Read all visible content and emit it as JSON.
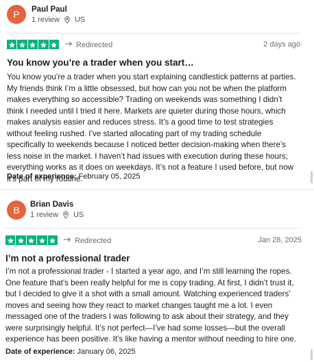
{
  "reviews": [
    {
      "reviewer": {
        "initial": "P",
        "name": "Paul Paul",
        "review_count": "1 review",
        "country": "US",
        "avatar_color": "#e4643c"
      },
      "rating_stars": 5,
      "redirected_label": "Redirected",
      "date": "2 days ago",
      "title": "You know you’re a trader when you start…",
      "body": "You know you’re a trader when you start explaining candlestick patterns at parties. My friends think I’m a little obsessed, but how can you not be when the platform makes everything so accessible? Trading on weekends was something I didn’t think I needed until I tried it here. Markets are quieter during those hours, which makes analysis easier and reduces stress. It’s a good time to test strategies without feeling rushed. I’ve started allocating part of my trading schedule specifically to weekends because I noticed better decision-making when there’s less noise in the market. I haven’t had issues with execution during these hours; everything works as it does on weekdays. It’s not a feature I used before, but now it’s part of my routine.",
      "experience_label": "Date of experience:",
      "experience_date": "February 05, 2025"
    },
    {
      "reviewer": {
        "initial": "B",
        "name": "Brian Davis",
        "review_count": "1 review",
        "country": "US",
        "avatar_color": "#e4643c"
      },
      "rating_stars": 5,
      "redirected_label": "Redirected",
      "date": "Jan 28, 2025",
      "title": "I’m not a professional trader",
      "body": "I’m not a professional trader - I started a year ago, and I’m still learning the ropes. One feature that’s been really helpful for me is copy trading. At first, I didn’t trust it, but I decided to give it a shot with a small amount. Watching experienced traders’ moves and seeing how they react to market changes taught me a lot. I even messaged one of the traders I was following to ask about their strategy, and they were surprisingly helpful. It’s not perfect—I’ve had some losses—but the overall experience has been positive. It’s like having a mentor without needing to hire one.",
      "experience_label": "Date of experience:",
      "experience_date": "January 06, 2025"
    }
  ],
  "colors": {
    "star_green": "#00b67a",
    "avatar": "#e4643c"
  },
  "icons": [
    "location-pin-icon",
    "star-icon",
    "redirect-arrow-icon"
  ]
}
